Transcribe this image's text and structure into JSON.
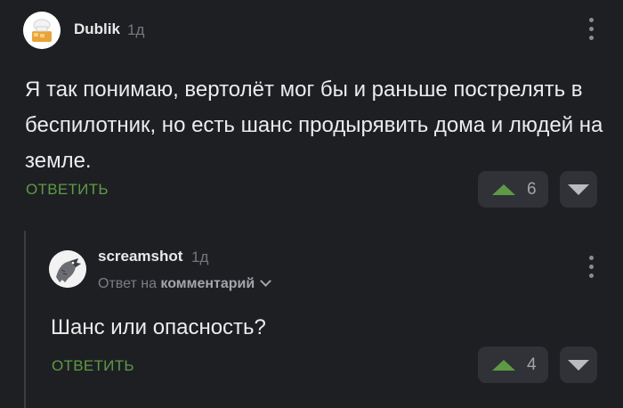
{
  "comments": [
    {
      "author": "Dublik",
      "time": "1д",
      "text": "Я так понимаю, вертолёт мог бы и раньше пострелять в беспилотник, но есть шанс продырявить дома и людей на земле.",
      "reply_label": "ОТВЕТИТЬ",
      "rating": "6"
    },
    {
      "author": "screamshot",
      "time": "1д",
      "reply_to_prefix": "Ответ на",
      "reply_to_target": "комментарий",
      "text": "Шанс или опасность?",
      "reply_label": "ОТВЕТИТЬ",
      "rating": "4"
    }
  ],
  "icons": {
    "more": "more-vertical-icon",
    "upvote": "arrow-up-triangle-icon",
    "downvote": "arrow-down-triangle-icon",
    "expand": "chevron-down-icon"
  },
  "colors": {
    "background": "#1e1f23",
    "accent_green": "#5e9a45",
    "button_bg": "#303237",
    "muted_text": "#75777d"
  }
}
